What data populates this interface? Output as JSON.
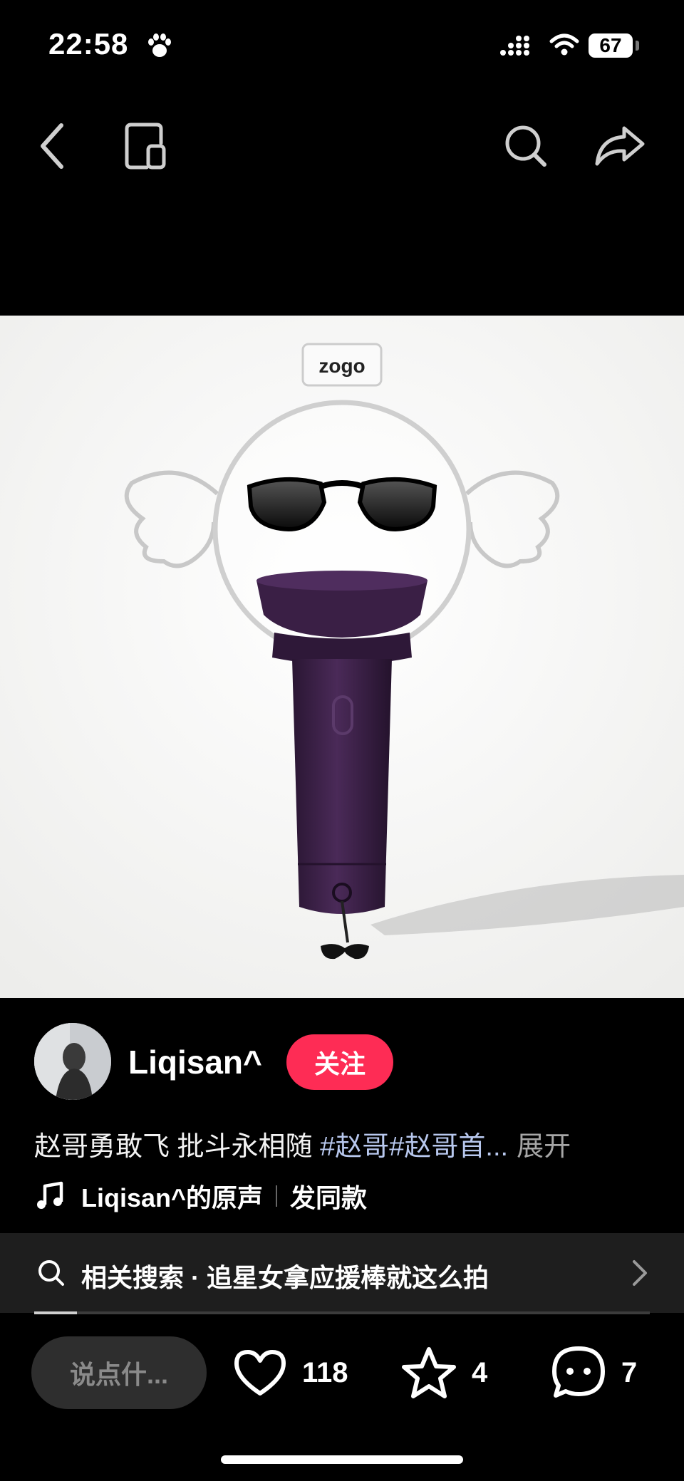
{
  "status_bar": {
    "time": "22:58",
    "battery": "67"
  },
  "nav": {
    "back": "back",
    "cast": "cast",
    "search": "search",
    "share": "share"
  },
  "media": {
    "logo_text": "zogo"
  },
  "author": {
    "username": "Liqisan^",
    "follow_label": "关注"
  },
  "caption": {
    "text": "赵哥勇敢飞 批斗永相随 ",
    "tags": "#赵哥#赵哥首...",
    "more": "展开"
  },
  "music": {
    "sound": "Liqisan^的原声",
    "same_label": "发同款"
  },
  "related_search": {
    "text": "相关搜索 · 追星女拿应援棒就这么拍",
    "progress": 0.07
  },
  "actions": {
    "comment_placeholder": "说点什...",
    "likes": "118",
    "favorites": "4",
    "comments": "7"
  },
  "colors": {
    "follow": "#fe2c55",
    "hashtag": "#b8c8ee",
    "stick": "#3a1f45"
  }
}
